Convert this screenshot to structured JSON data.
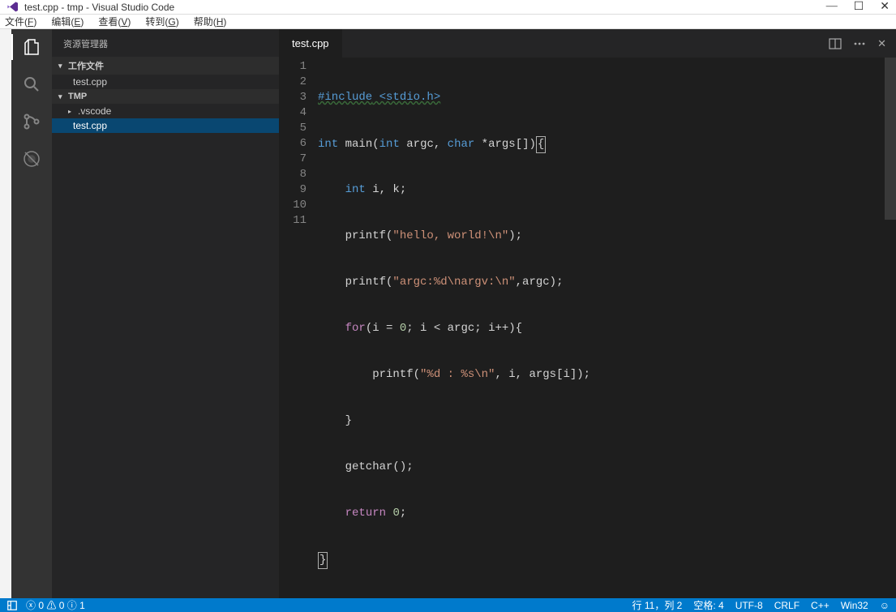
{
  "window": {
    "title": "test.cpp - tmp - Visual Studio Code"
  },
  "menu": {
    "file": "文件(",
    "file_u": "F",
    "file2": ")",
    "edit": "编辑(",
    "edit_u": "E",
    "edit2": ")",
    "view": "查看(",
    "view_u": "V",
    "view2": ")",
    "goto": "转到(",
    "goto_u": "G",
    "goto2": ")",
    "help": "帮助(",
    "help_u": "H",
    "help2": ")"
  },
  "sidebar": {
    "title": "资源管理器",
    "open_editors_label": "工作文件",
    "open_file": "test.cpp",
    "folder_label": "TMP",
    "vscode_folder": ".vscode",
    "testcpp": "test.cpp"
  },
  "tab": {
    "name": "test.cpp"
  },
  "code": {
    "l1a": "#include",
    "l1b": " <stdio.h>",
    "l2a": "int",
    "l2b": " main(",
    "l2c": "int",
    "l2d": " argc, ",
    "l2e": "char",
    "l2f": " *args[])",
    "l2g": "{",
    "l3a": "    ",
    "l3b": "int",
    "l3c": " i, k;",
    "l4a": "    printf(",
    "l4b": "\"hello, world!\\n\"",
    "l4c": ");",
    "l5a": "    printf(",
    "l5b": "\"argc:%d\\nargv:\\n\"",
    "l5c": ",argc);",
    "l6a": "    ",
    "l6b": "for",
    "l6c": "(i = ",
    "l6d": "0",
    "l6e": "; i < argc; i++){",
    "l7a": "        printf(",
    "l7b": "\"%d : %s\\n\"",
    "l7c": ", i, args[i]);",
    "l8": "    }",
    "l9": "    getchar();",
    "l10a": "    ",
    "l10b": "return",
    "l10c": " ",
    "l10d": "0",
    "l10e": ";",
    "l11": "}"
  },
  "lines": [
    "1",
    "2",
    "3",
    "4",
    "5",
    "6",
    "7",
    "8",
    "9",
    "10",
    "11"
  ],
  "status": {
    "errors": "0",
    "warnings": "0",
    "info": "1",
    "pos": "行 11，列 2",
    "spaces": "空格: 4",
    "enc": "UTF-8",
    "eol": "CRLF",
    "lang": "C++",
    "target": "Win32"
  }
}
